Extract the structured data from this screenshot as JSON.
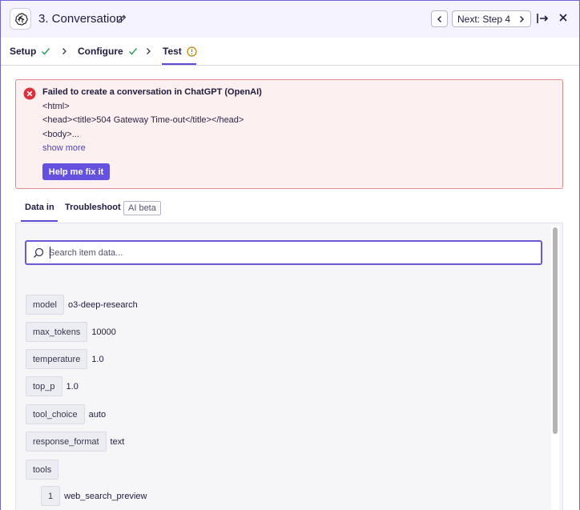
{
  "header": {
    "title": "3. Conversation",
    "next_label": "Next: Step 4",
    "app_icon": "openai-logo-icon"
  },
  "steps": [
    {
      "label": "Setup",
      "status": "complete"
    },
    {
      "label": "Configure",
      "status": "complete"
    },
    {
      "label": "Test",
      "status": "warning"
    }
  ],
  "error": {
    "title": "Failed to create a conversation in ChatGPT (OpenAI)",
    "lines": [
      "<html>",
      "<head><title>504 Gateway Time-out</title></head>",
      "<body>..."
    ],
    "show_more": "show more",
    "fix_button": "Help me fix it"
  },
  "data_tabs": {
    "data_in": "Data in",
    "troubleshoot": "Troubleshoot",
    "ai_badge": "AI beta"
  },
  "search": {
    "placeholder": "Search item data..."
  },
  "items": [
    {
      "key": "model",
      "value": "o3-deep-research"
    },
    {
      "key": "max_tokens",
      "value": "10000"
    },
    {
      "key": "temperature",
      "value": "1.0"
    },
    {
      "key": "top_p",
      "value": "1.0"
    },
    {
      "key": "tool_choice",
      "value": "auto"
    },
    {
      "key": "response_format",
      "value": "text"
    },
    {
      "key": "tools",
      "value": ""
    }
  ],
  "tools_children": [
    {
      "key": "1",
      "value": "web_search_preview"
    }
  ],
  "colors": {
    "accent": "#6551e0",
    "error_bg": "#fdf0f0",
    "error_border": "#e08b8b",
    "success": "#2f9e5a",
    "warning": "#b8860b"
  }
}
